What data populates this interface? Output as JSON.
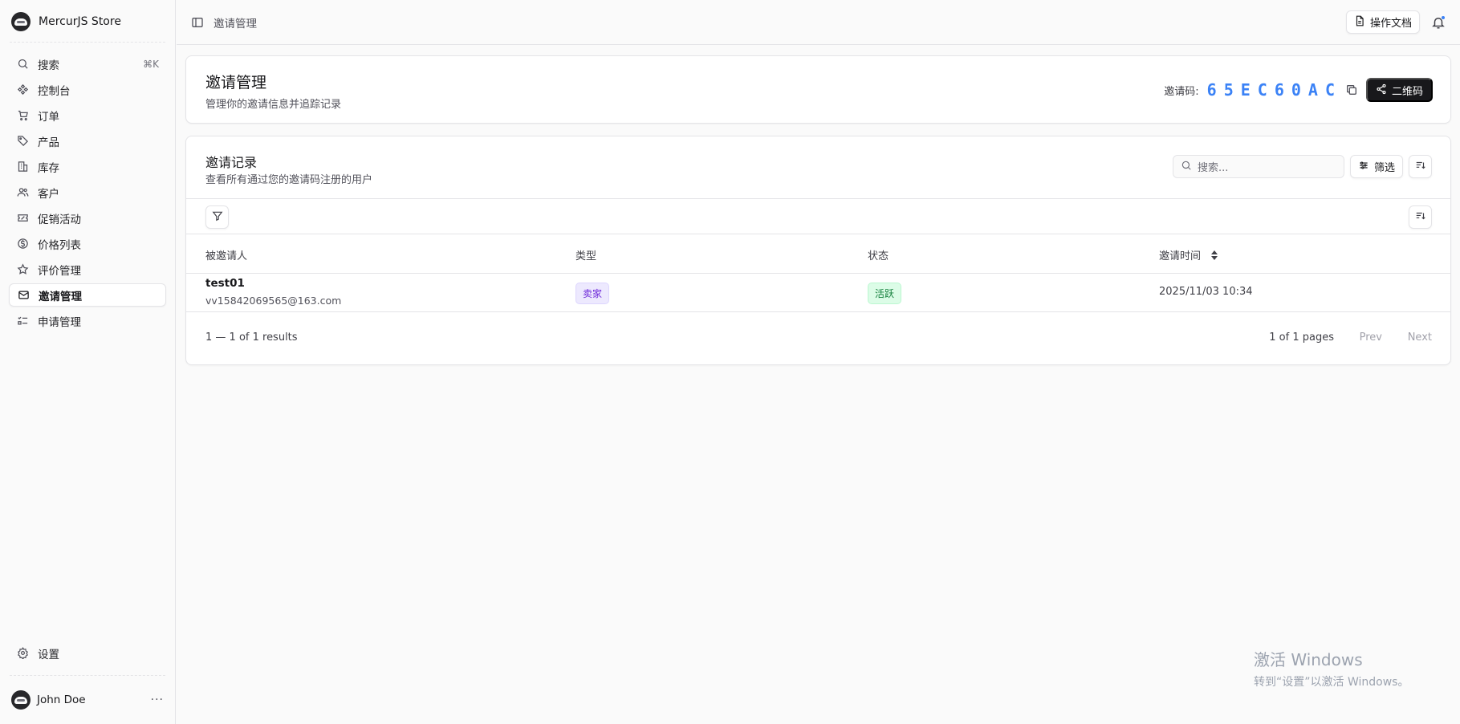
{
  "app": {
    "name": "MercurJS Store"
  },
  "sidebar": {
    "items": [
      {
        "label": "搜索",
        "icon": "search-icon",
        "shortcut": "⌘K"
      },
      {
        "label": "控制台",
        "icon": "dashboard-icon"
      },
      {
        "label": "订单",
        "icon": "cart-icon"
      },
      {
        "label": "产品",
        "icon": "tag-icon"
      },
      {
        "label": "库存",
        "icon": "building-icon"
      },
      {
        "label": "客户",
        "icon": "users-icon"
      },
      {
        "label": "促销活动",
        "icon": "ticket-icon"
      },
      {
        "label": "价格列表",
        "icon": "dollar-icon"
      },
      {
        "label": "评价管理",
        "icon": "star-icon"
      },
      {
        "label": "邀请管理",
        "icon": "mail-icon",
        "active": true
      },
      {
        "label": "申请管理",
        "icon": "checklist-icon"
      }
    ],
    "settings_label": "设置",
    "user": {
      "name": "John Doe",
      "more": "···"
    }
  },
  "topbar": {
    "breadcrumb": "邀请管理",
    "docs_label": "操作文档"
  },
  "invite_card": {
    "title": "邀请管理",
    "subtitle": "管理你的邀请信息并追踪记录",
    "code_label": "邀请码:",
    "code": "65EC60AC",
    "qr_button": "二维码"
  },
  "records": {
    "title": "邀请记录",
    "subtitle": "查看所有通过您的邀请码注册的用户",
    "search_placeholder": "搜索...",
    "filter_label": "筛选",
    "columns": [
      "被邀请人",
      "类型",
      "状态",
      "邀请时间"
    ],
    "rows": [
      {
        "name": "test01",
        "email": "vv15842069565@163.com",
        "type": "卖家",
        "status": "活跃",
        "time": "2025/11/03 10:34"
      }
    ],
    "pagination": {
      "range": "1 — 1 of 1 results",
      "pages": "1 of 1 pages",
      "prev": "Prev",
      "next": "Next"
    }
  },
  "watermark": {
    "line1": "激活 Windows",
    "line2": "转到“设置”以激活 Windows。"
  },
  "colors": {
    "accent": "#3b82f6",
    "dark_button": "#18181b",
    "badge_type": "#ede9fe",
    "badge_status": "#dcfce7"
  }
}
